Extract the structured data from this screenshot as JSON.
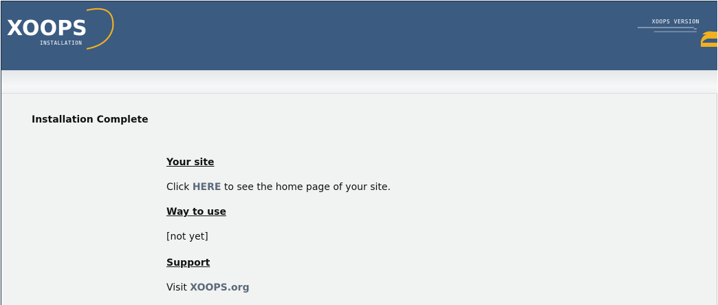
{
  "header": {
    "logo_text": "XOOPS",
    "logo_subtitle": "INSTALLATION",
    "version_label": "XOOPS VERSION",
    "colors": {
      "header_bg": "#3b5b81",
      "accent": "#f0b020"
    }
  },
  "main": {
    "title": "Installation Complete",
    "sections": [
      {
        "heading": "Your site",
        "prefix": "Click ",
        "link": "HERE",
        "suffix": " to see the home page of your site."
      },
      {
        "heading": "Way to use",
        "text": "[not yet]"
      },
      {
        "heading": "Support",
        "prefix": "Visit ",
        "link": "XOOPS.org"
      }
    ]
  }
}
